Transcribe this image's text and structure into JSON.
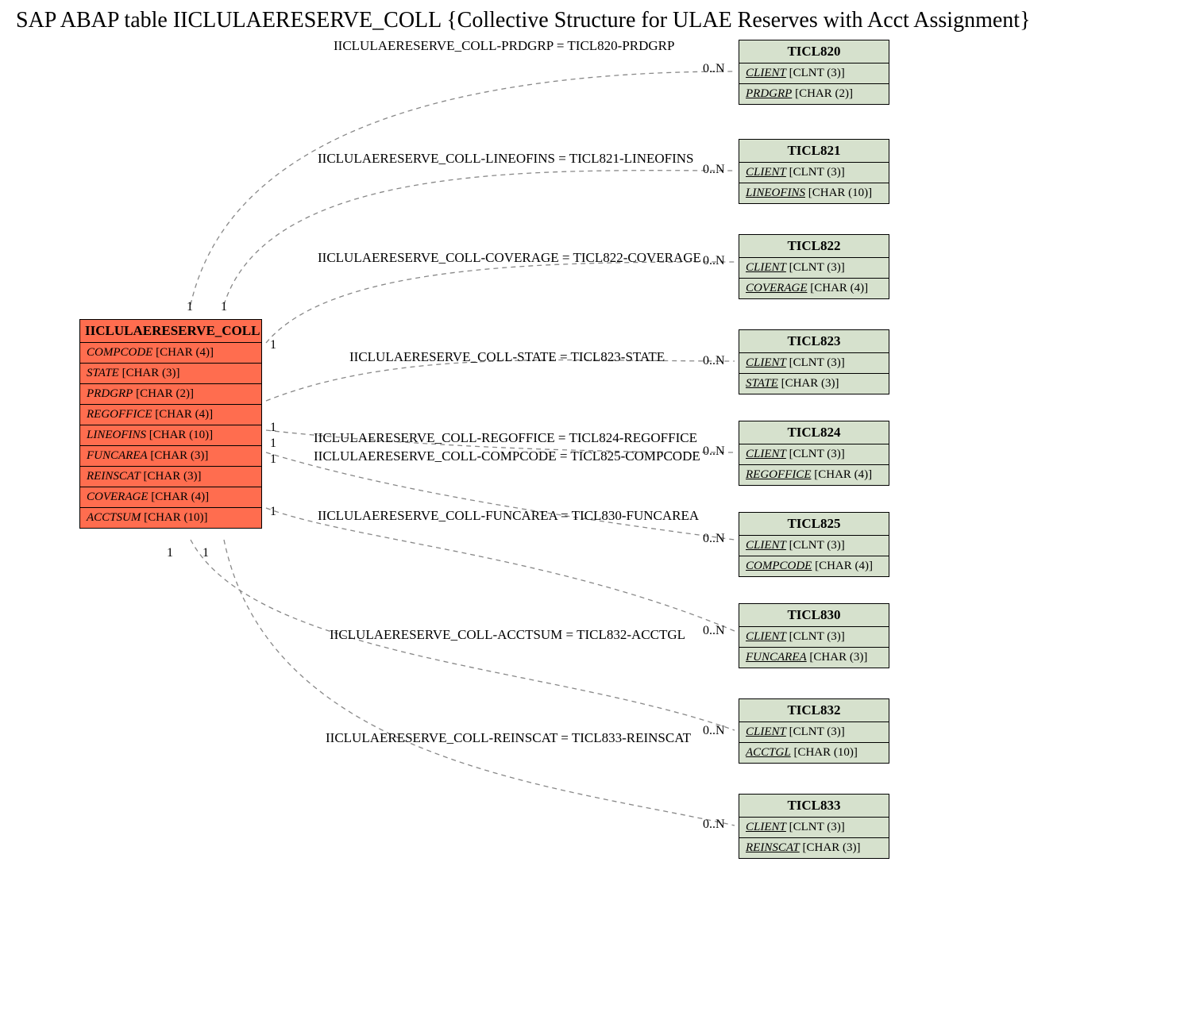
{
  "title": {
    "prefix": "SAP ABAP table ",
    "table": "IICLULAERESERVE_COLL ",
    "desc": "{Collective Structure for ULAE Reserves with Acct Assignment}"
  },
  "cards": {
    "one": "1",
    "zeroN": "0..N"
  },
  "main": {
    "name": "IICLULAERESERVE_COLL",
    "fields": [
      {
        "name": "COMPCODE",
        "type": "[CHAR (4)]"
      },
      {
        "name": "STATE",
        "type": "[CHAR (3)]"
      },
      {
        "name": "PRDGRP",
        "type": "[CHAR (2)]"
      },
      {
        "name": "REGOFFICE",
        "type": "[CHAR (4)]"
      },
      {
        "name": "LINEOFINS",
        "type": "[CHAR (10)]"
      },
      {
        "name": "FUNCAREA",
        "type": "[CHAR (3)]"
      },
      {
        "name": "REINSCAT",
        "type": "[CHAR (3)]"
      },
      {
        "name": "COVERAGE",
        "type": "[CHAR (4)]"
      },
      {
        "name": "ACCTSUM",
        "type": "[CHAR (10)]"
      }
    ]
  },
  "relations": [
    {
      "label": "IICLULAERESERVE_COLL-PRDGRP = TICL820-PRDGRP"
    },
    {
      "label": "IICLULAERESERVE_COLL-LINEOFINS = TICL821-LINEOFINS"
    },
    {
      "label": "IICLULAERESERVE_COLL-COVERAGE = TICL822-COVERAGE"
    },
    {
      "label": "IICLULAERESERVE_COLL-STATE = TICL823-STATE"
    },
    {
      "label": "IICLULAERESERVE_COLL-REGOFFICE = TICL824-REGOFFICE"
    },
    {
      "label": "IICLULAERESERVE_COLL-COMPCODE = TICL825-COMPCODE"
    },
    {
      "label": "IICLULAERESERVE_COLL-FUNCAREA = TICL830-FUNCAREA"
    },
    {
      "label": "IICLULAERESERVE_COLL-ACCTSUM = TICL832-ACCTGL"
    },
    {
      "label": "IICLULAERESERVE_COLL-REINSCAT = TICL833-REINSCAT"
    }
  ],
  "related": [
    {
      "name": "TICL820",
      "fields": [
        {
          "name": "CLIENT",
          "type": "[CLNT (3)]"
        },
        {
          "name": "PRDGRP",
          "type": "[CHAR (2)]"
        }
      ]
    },
    {
      "name": "TICL821",
      "fields": [
        {
          "name": "CLIENT",
          "type": "[CLNT (3)]"
        },
        {
          "name": "LINEOFINS",
          "type": "[CHAR (10)]"
        }
      ]
    },
    {
      "name": "TICL822",
      "fields": [
        {
          "name": "CLIENT",
          "type": "[CLNT (3)]"
        },
        {
          "name": "COVERAGE",
          "type": "[CHAR (4)]"
        }
      ]
    },
    {
      "name": "TICL823",
      "fields": [
        {
          "name": "CLIENT",
          "type": "[CLNT (3)]"
        },
        {
          "name": "STATE",
          "type": "[CHAR (3)]"
        }
      ]
    },
    {
      "name": "TICL824",
      "fields": [
        {
          "name": "CLIENT",
          "type": "[CLNT (3)]"
        },
        {
          "name": "REGOFFICE",
          "type": "[CHAR (4)]"
        }
      ]
    },
    {
      "name": "TICL825",
      "fields": [
        {
          "name": "CLIENT",
          "type": "[CLNT (3)]"
        },
        {
          "name": "COMPCODE",
          "type": "[CHAR (4)]"
        }
      ]
    },
    {
      "name": "TICL830",
      "fields": [
        {
          "name": "CLIENT",
          "type": "[CLNT (3)]"
        },
        {
          "name": "FUNCAREA",
          "type": "[CHAR (3)]"
        }
      ]
    },
    {
      "name": "TICL832",
      "fields": [
        {
          "name": "CLIENT",
          "type": "[CLNT (3)]"
        },
        {
          "name": "ACCTGL",
          "type": "[CHAR (10)]"
        }
      ]
    },
    {
      "name": "TICL833",
      "fields": [
        {
          "name": "CLIENT",
          "type": "[CLNT (3)]"
        },
        {
          "name": "REINSCAT",
          "type": "[CHAR (3)]"
        }
      ]
    }
  ]
}
